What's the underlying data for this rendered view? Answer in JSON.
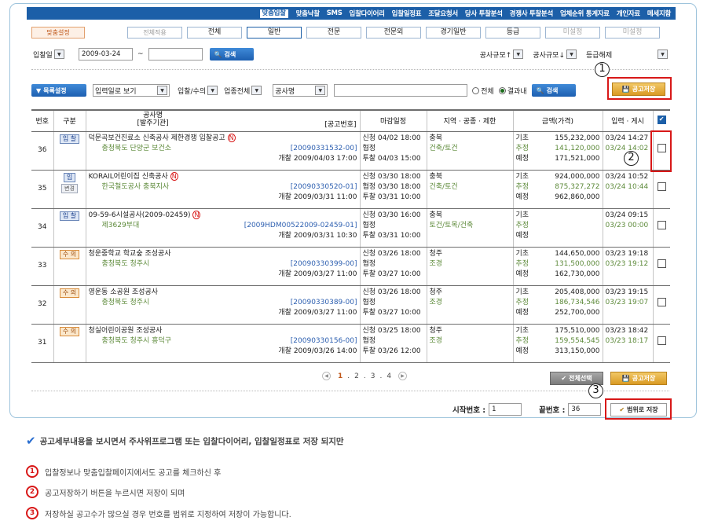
{
  "nav": [
    "맞춤입찰",
    "맞춤낙찰",
    "SMS",
    "입찰다이어리",
    "입찰일정표",
    "조달요청서",
    "당사 투찰분석",
    "경쟁사 투찰분석",
    "업체순위 통계자료",
    "개인자료",
    "메세지함"
  ],
  "filters": {
    "setting_label": "맞춤설정",
    "apply_all": "전체적용",
    "tabs": [
      "전체",
      "일반",
      "전문",
      "전문외",
      "경기일반",
      "등급",
      "미설정",
      "미설정"
    ],
    "date_type": "입찰일",
    "date_from": "2009-03-24",
    "tilde": "~",
    "date_to": "",
    "search": "검색",
    "sort1": "공사규모↑",
    "sort2": "공사규모↓",
    "sort3": "등급해제"
  },
  "toolbar": {
    "list_setting": "목록설정",
    "view": "입력일로 보기",
    "type": "입찰/수의",
    "industry": "업종전체",
    "field": "공사명",
    "keyword": "",
    "radio_all": "전체",
    "radio_in": "결과내",
    "search": "검색",
    "save": "공고저장"
  },
  "headers": {
    "no": "번호",
    "kind": "구분",
    "name": "공사명",
    "owner": "[발주기관]",
    "code": "[공고번호]",
    "deadline": "마감일정",
    "region": "지역 · 공종 · 제한",
    "amount": "금액(가격)",
    "posted": "입력 · 게시"
  },
  "rows": [
    {
      "no": "36",
      "kind": "입 찰",
      "kind2": "",
      "style": "blue",
      "name": "덕문곡보건진료소 신축공사 제한경쟁 입찰공고",
      "owner": "충청북도 단양군 보건소",
      "code": "[20090331532-00]",
      "open": "개찰  2009/04/03 17:00",
      "d1": "신청  04/02 18:00",
      "d2": "협정",
      "d3": "투찰  04/03 15:00",
      "r1": "충북",
      "r2": "건축/토건",
      "a1": "155,232,000",
      "a2": "141,120,000",
      "a3": "171,521,000",
      "p1": "03/24 14:27",
      "p2": "03/24 14:02",
      "checked": false
    },
    {
      "no": "35",
      "kind": "입",
      "kind2": "변경",
      "style": "blue",
      "name": "KORAIL어린이집 신축공사",
      "owner": "한국철도공사 충북지사",
      "code": "[20090330520-01]",
      "open": "개찰  2009/03/31 11:00",
      "d1": "신청  03/30 18:00",
      "d2": "협정  03/30 18:00",
      "d3": "투찰  03/31 10:00",
      "r1": "충북",
      "r2": "건축/토건",
      "a1": "924,000,000",
      "a2": "875,327,272",
      "a3": "962,860,000",
      "p1": "03/24 10:52",
      "p2": "03/24 10:44",
      "checked": false
    },
    {
      "no": "34",
      "kind": "입 찰",
      "kind2": "",
      "style": "blue",
      "name": "09-59-6시설공사(2009-02459)",
      "owner": "제3629부대",
      "code": "[2009HDM00522009-02459-01]",
      "open": "개찰  2009/03/31 10:30",
      "d1": "신청  03/30 16:00",
      "d2": "협정",
      "d3": "투찰  03/31 10:00",
      "r1": "충북",
      "r2": "토건/토목/건축",
      "a1": "",
      "a2": "",
      "a3": "",
      "p1": "03/24 09:15",
      "p2": "03/23 00:00",
      "checked": false
    },
    {
      "no": "33",
      "kind": "수 의",
      "kind2": "",
      "style": "orange",
      "name": "청운중학교 학교숲 조성공사",
      "owner": "충청북도 청주시",
      "code": "[20090330399-00]",
      "open": "개찰  2009/03/27 11:00",
      "d1": "신청  03/26 18:00",
      "d2": "협정",
      "d3": "투찰  03/27 10:00",
      "r1": "청주",
      "r2": "조경",
      "a1": "144,650,000",
      "a2": "131,500,000",
      "a3": "162,730,000",
      "p1": "03/23 19:18",
      "p2": "03/23 19:12",
      "checked": false
    },
    {
      "no": "32",
      "kind": "수 의",
      "kind2": "",
      "style": "orange",
      "name": "영운동 소공원 조성공사",
      "owner": "충청북도 청주시",
      "code": "[20090330389-00]",
      "open": "개찰  2009/03/27 11:00",
      "d1": "신청  03/26 18:00",
      "d2": "협정",
      "d3": "투찰  03/27 10:00",
      "r1": "청주",
      "r2": "조경",
      "a1": "205,408,000",
      "a2": "186,734,546",
      "a3": "252,700,000",
      "p1": "03/23 19:15",
      "p2": "03/23 19:07",
      "checked": false
    },
    {
      "no": "31",
      "kind": "수 의",
      "kind2": "",
      "style": "orange",
      "name": "청실어린이공원 조성공사",
      "owner": "충청북도 청주시 흥덕구",
      "code": "[20090330156-00]",
      "open": "개찰  2009/03/26 14:00",
      "d1": "신청  03/25 18:00",
      "d2": "협정",
      "d3": "투찰  03/26 12:00",
      "r1": "청주",
      "r2": "조경",
      "a1": "175,510,000",
      "a2": "159,554,545",
      "a3": "313,150,000",
      "p1": "03/23 18:42",
      "p2": "03/23 18:17",
      "checked": false
    }
  ],
  "amount_labels": [
    "기초",
    "추정",
    "예정"
  ],
  "pager": {
    "pages": [
      "1",
      ".",
      "2",
      ".",
      "3",
      ".",
      "4"
    ],
    "current": "1"
  },
  "bottom": {
    "select_all": "전체선택",
    "save": "공고저장",
    "start_label": "시작번호 :",
    "start": "1",
    "end_label": "끝번호 :",
    "end": "36",
    "range_save": "범위로 저장"
  },
  "callouts": [
    "1",
    "2",
    "3"
  ],
  "notes": {
    "headline": "공고세부내용을 보시면서 주사위프로그램 또는 입찰다이어리, 입찰일정표로 저장 되지만",
    "items": [
      {
        "num": "1",
        "text": "입찰정보나 맞춤입찰페이지에서도 공고를 체크하신 후"
      },
      {
        "num": "2",
        "text": "공고저장하기 버튼을 누르시면 저장이 되며"
      },
      {
        "num": "3",
        "text": "저장하실 공고수가 많으실 경우 번호를 범위로 지정하여  저장이 가능합니다."
      }
    ]
  },
  "colors": {
    "nav": "#1c5fa8",
    "accent_red": "#d81818",
    "gold": "#d99a24"
  }
}
